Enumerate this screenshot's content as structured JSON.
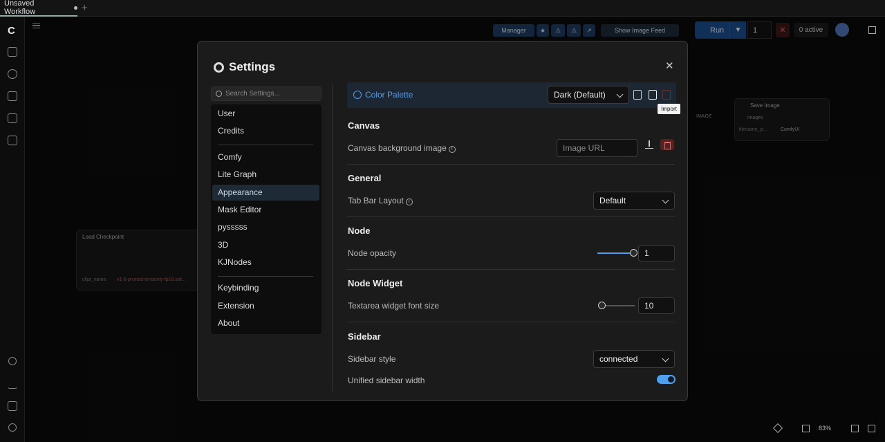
{
  "tabbar": {
    "workflow_tab": "Unsaved Workflow",
    "add_tab": "+"
  },
  "topbar": {
    "manager": "Manager",
    "show_image_feed": "Show Image Feed",
    "run": "Run",
    "run_count": "1",
    "stop": "✕",
    "active": "0 active"
  },
  "canvas": {
    "load_checkpoint": {
      "title": "Load Checkpoint",
      "field": "ckpt_name",
      "value": "v1-5-pruned-emaonly-fp16.saf..."
    },
    "save_image": {
      "title": "Save Image",
      "input": "images",
      "field": "filename_p...",
      "value": "ComfyUI"
    },
    "image_port": "IMAGE",
    "zoom": "83%"
  },
  "dialog": {
    "title": "Settings",
    "search_placeholder": "Search Settings...",
    "nav": {
      "group1": [
        "User",
        "Credits"
      ],
      "group2": [
        "Comfy",
        "Lite Graph",
        "Appearance",
        "Mask Editor",
        "pysssss",
        "3D",
        "KJNodes"
      ],
      "group3": [
        "Keybinding",
        "Extension",
        "About"
      ],
      "selected": "Appearance"
    },
    "palette": {
      "label": "Color Palette",
      "value": "Dark (Default)",
      "tooltip": "Import"
    },
    "sections": {
      "canvas": {
        "title": "Canvas",
        "bg_label": "Canvas background image",
        "bg_placeholder": "Image URL"
      },
      "general": {
        "title": "General",
        "tab_bar_label": "Tab Bar Layout",
        "tab_bar_value": "Default"
      },
      "node": {
        "title": "Node",
        "opacity_label": "Node opacity",
        "opacity_value": "1"
      },
      "node_widget": {
        "title": "Node Widget",
        "font_label": "Textarea widget font size",
        "font_value": "10"
      },
      "sidebar": {
        "title": "Sidebar",
        "style_label": "Sidebar style",
        "style_value": "connected",
        "width_label": "Unified sidebar width"
      }
    }
  }
}
